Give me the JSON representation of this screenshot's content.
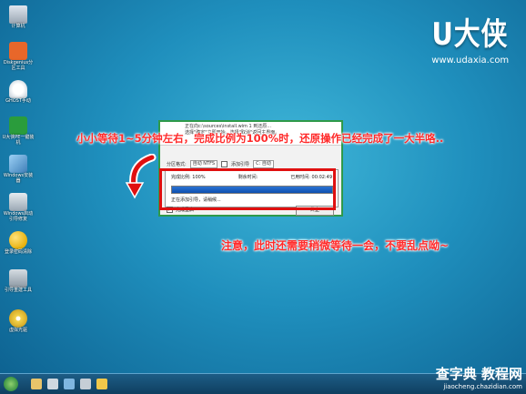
{
  "desktop_icons": [
    {
      "label": "计算机",
      "icon": "computer-icon",
      "color": "#bfc7d0"
    },
    {
      "label": "Diskgenius分区工具",
      "icon": "diskgenius-icon",
      "color": "#e8672a"
    },
    {
      "label": "GHOST手动",
      "icon": "ghost-icon",
      "color": "#e9e9e9"
    },
    {
      "label": "U大侠PE一键装机",
      "icon": "uinstall-icon",
      "color": "#2a9c3c"
    },
    {
      "label": "Windows安装器",
      "icon": "windows-installer-icon",
      "color": "#6aa8d8"
    },
    {
      "label": "Windows启动引导修复",
      "icon": "boot-repair-icon",
      "color": "#c9d3dc"
    },
    {
      "label": "登录密码清除",
      "icon": "key-icon",
      "color": "#f0c419"
    },
    {
      "label": "引导重建工具",
      "icon": "rebuild-icon",
      "color": "#b0b8c0"
    },
    {
      "label": "虚拟光驱",
      "icon": "cd-icon",
      "color": "#f3d34a"
    }
  ],
  "brand": {
    "logo": "U大侠",
    "url": "www.udaxia.com"
  },
  "window": {
    "line1": "正在向c:\\sources\\install.wim 1 到还原...",
    "line2": "选择\"确定\"立即开始，选择\"取消\"返回主界面。",
    "partition_label": "分区格式:",
    "partition_value": "自动 NTFS",
    "add_boot_label": "添加引导",
    "drive_value": "C: 自动",
    "progress": {
      "ratio_label": "完成比例: 100%",
      "remaining_label": "剩余时间:",
      "elapsed_label": "已用时间: 00:02:49",
      "fraction": 1.0,
      "status": "正在添加引导，请稍候..."
    },
    "reboot_label": "完成重启",
    "stop_label": "终止"
  },
  "captions": {
    "top": "小小等待1~5分钟左右，完成比例为100%时，还原操作已经完成了一大半咯..",
    "bottom": "注意，此时还需要稍微等待一会，不要乱点呦~"
  },
  "watermark": {
    "line1": "查字典 教程网",
    "line2": "jiaocheng.chazidian.com"
  },
  "colors": {
    "caption_red": "#ff2a2a",
    "frame_red": "#e01010",
    "window_border": "#2f9a4a"
  }
}
